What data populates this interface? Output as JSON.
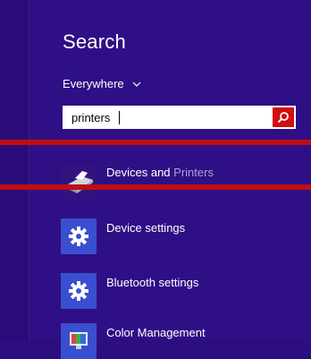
{
  "search": {
    "title": "Search",
    "scope_label": "Everywhere",
    "query": "printers"
  },
  "results": [
    {
      "label_main": "Devices and ",
      "label_muted": "Printers",
      "icon": "printer-icon"
    },
    {
      "label": "Device settings",
      "icon": "gear-icon"
    },
    {
      "label": "Bluetooth settings",
      "icon": "gear-icon"
    },
    {
      "label": "Color Management",
      "icon": "color-management-icon"
    }
  ],
  "colors": {
    "background": "#2f0f85",
    "accent_red": "#c00d12",
    "search_button": "#d10f0f",
    "tile_blue": "#3a4fcf"
  }
}
